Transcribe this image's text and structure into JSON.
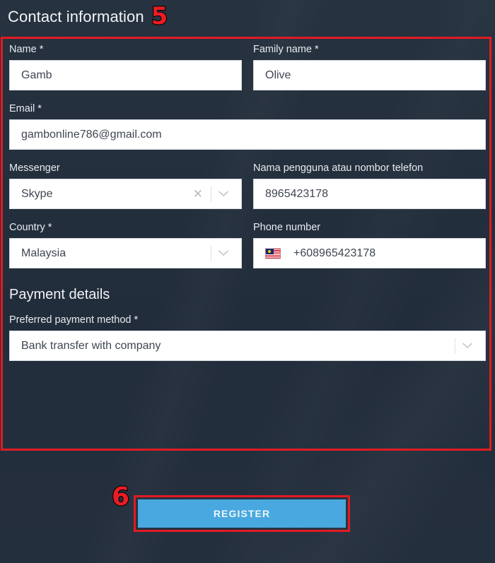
{
  "section": {
    "title": "Contact information",
    "marker": "5"
  },
  "fields": {
    "name": {
      "label": "Name *",
      "value": "Gamb"
    },
    "family_name": {
      "label": "Family name *",
      "value": "Olive"
    },
    "email": {
      "label": "Email *",
      "value": "gambonline786@gmail.com"
    },
    "messenger": {
      "label": "Messenger",
      "value": "Skype",
      "clear_icon": "close-icon",
      "chevron_icon": "chevron-down-icon"
    },
    "messenger_handle": {
      "label": "Nama pengguna atau nombor telefon",
      "value": "8965423178"
    },
    "country": {
      "label": "Country *",
      "value": "Malaysia",
      "chevron_icon": "chevron-down-icon"
    },
    "phone": {
      "label": "Phone number",
      "value": "+608965423178",
      "flag_icon": "malaysia-flag-icon"
    }
  },
  "payment": {
    "heading": "Payment details",
    "method": {
      "label": "Preferred payment method *",
      "value": "Bank transfer with company",
      "chevron_icon": "chevron-down-icon"
    }
  },
  "submit": {
    "label": "REGISTER",
    "marker": "6"
  },
  "colors": {
    "background": "#232f3e",
    "annotation": "#e11b22",
    "button": "#48a8df",
    "input_bg": "#ffffff",
    "label_text": "#e8ebef"
  }
}
